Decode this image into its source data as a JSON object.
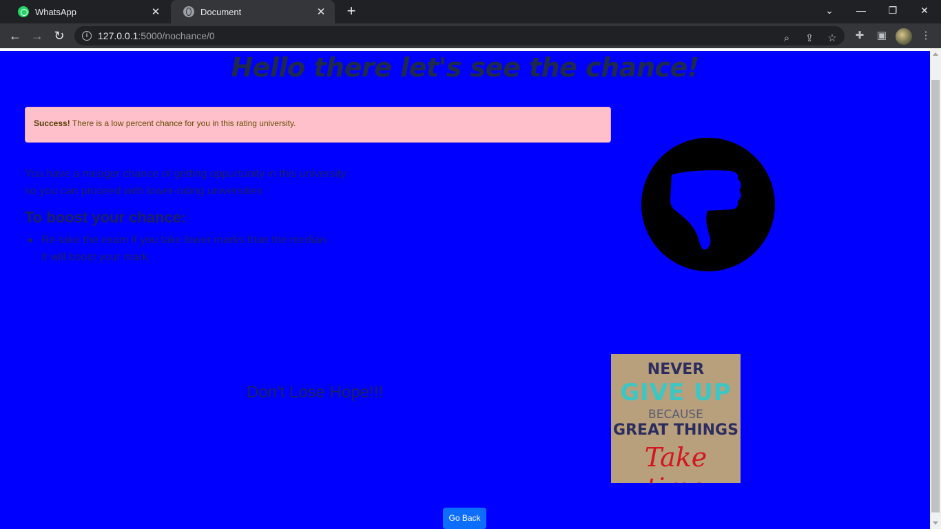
{
  "browser": {
    "tabs": [
      {
        "title": "WhatsApp",
        "active": false,
        "icon": "whatsapp-icon"
      },
      {
        "title": "Document",
        "active": true,
        "icon": "globe-icon"
      }
    ],
    "url_host": "127.0.0.1",
    "url_path": ":5000/nochance/0"
  },
  "page": {
    "background_color": "#0000ff",
    "heading": "Hello there let's see the chance!",
    "alert": {
      "strong": "Success!",
      "text": " There is a low percent chance for you in this rating university."
    },
    "message_line1": "You have a meager chance of getting oppurtunity in this university",
    "message_line2": "so you can proceed with lower-rating universities",
    "boost_title": "To boost your chance:",
    "tip_line1": "Re-take the exam if you take lower marks than the median",
    "tip_line2": "It will boost your mark",
    "hope_text": "Don't Lose Hope!!!",
    "poster": {
      "line1": "NEVER",
      "line2": "GIVE UP",
      "line3": "BECAUSE",
      "line4": "GREAT THINGS",
      "line5": "Take time"
    },
    "go_back_label": "Go Back"
  }
}
